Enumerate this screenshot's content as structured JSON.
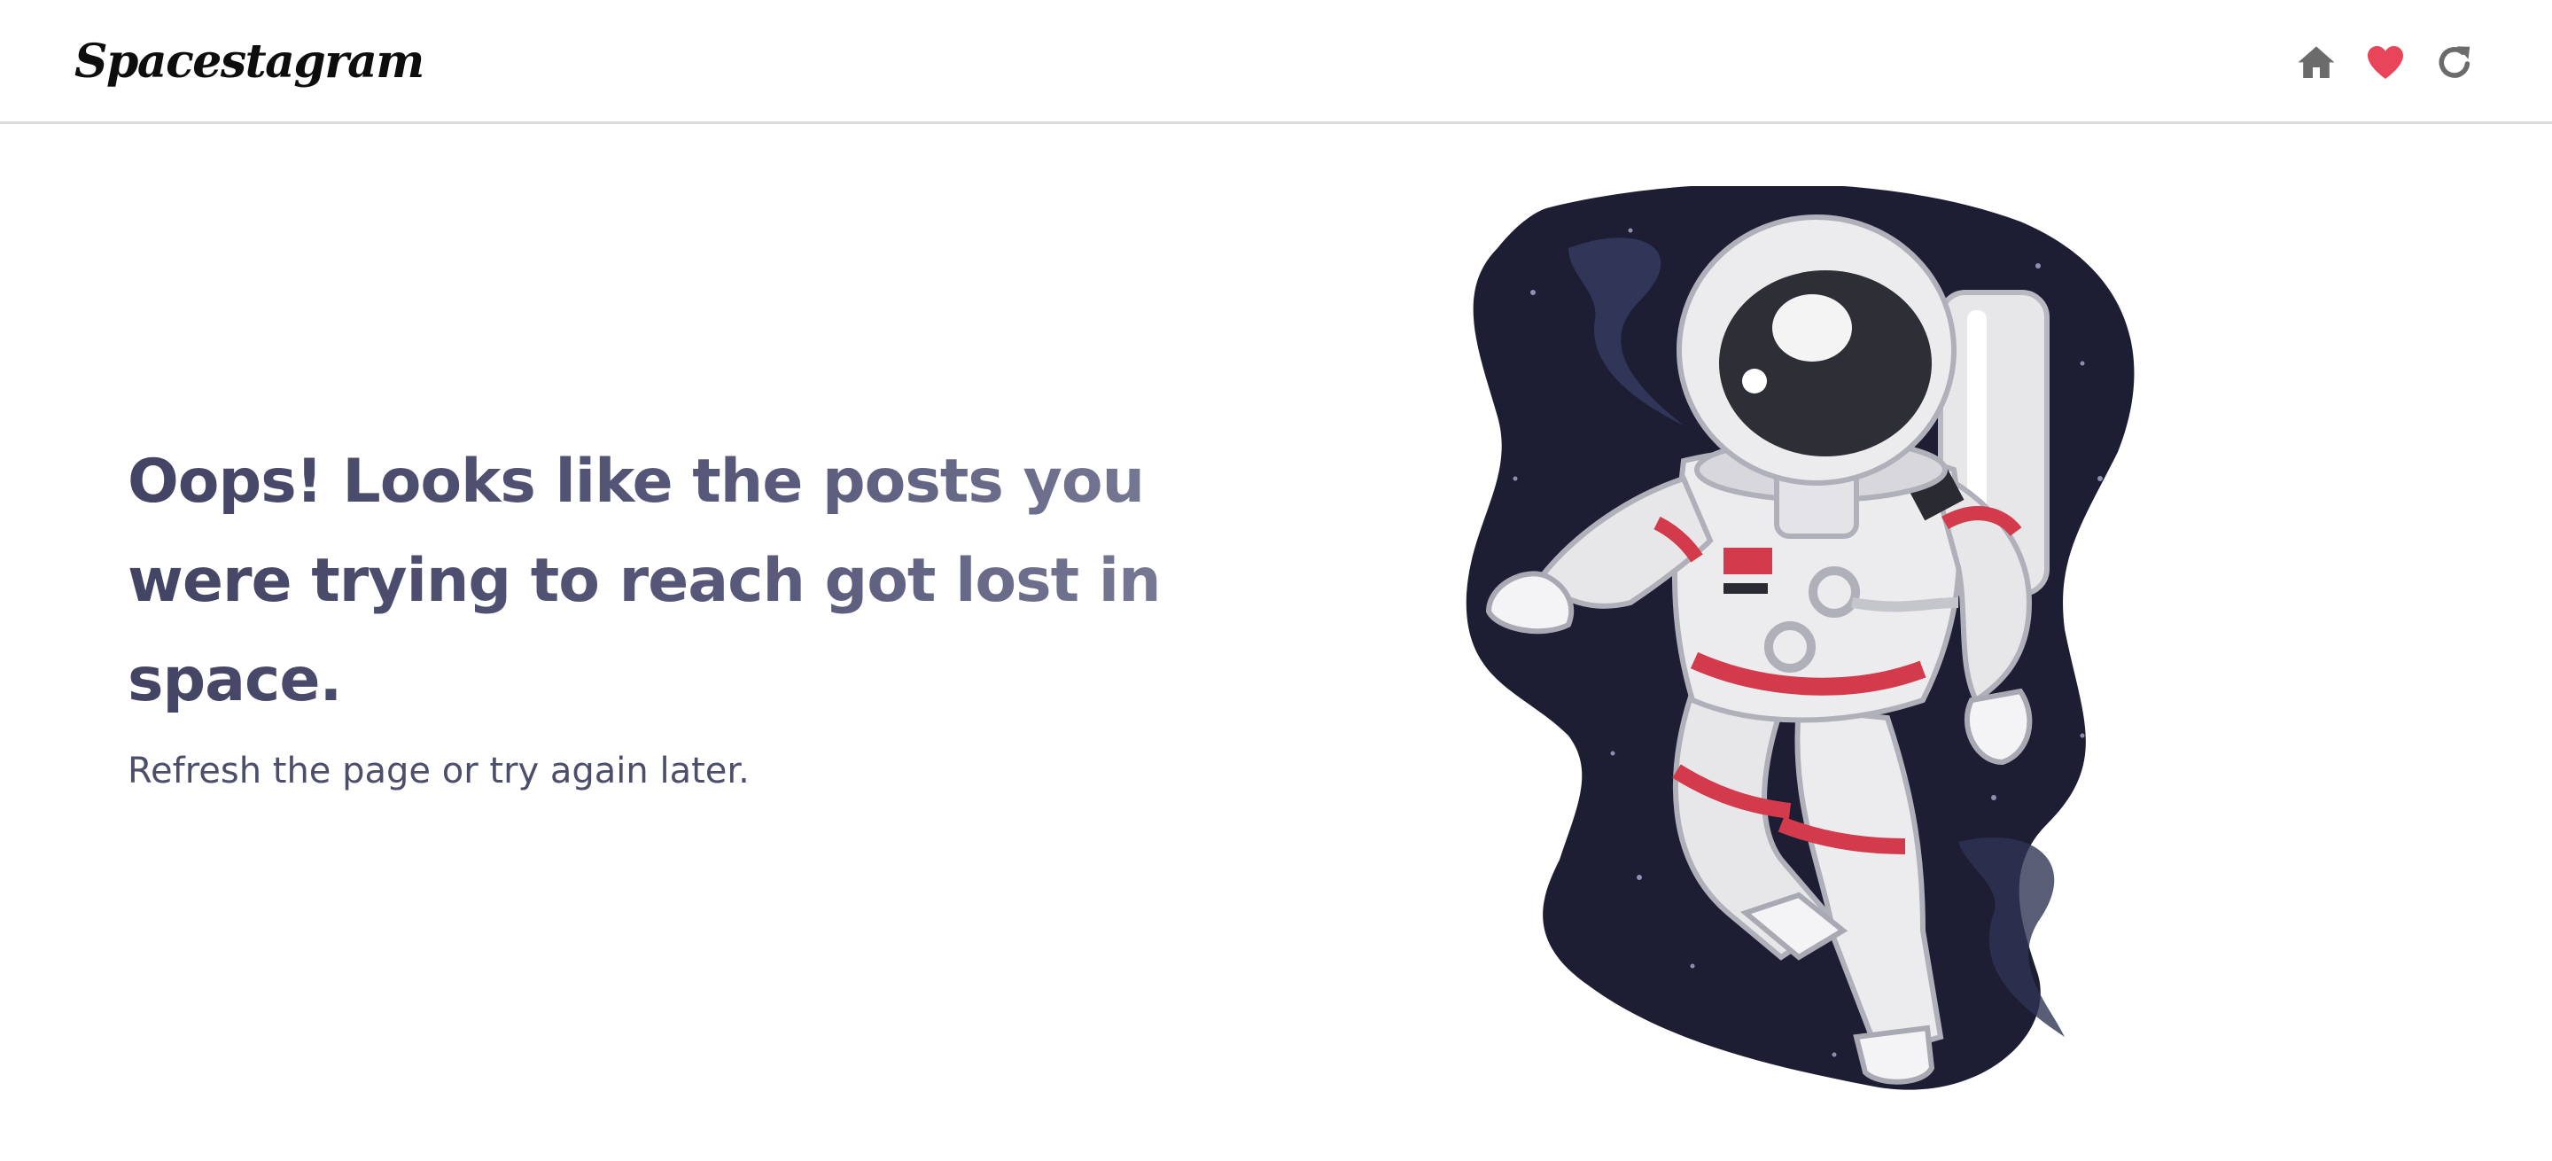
{
  "app": {
    "logo": "Spacestagram"
  },
  "nav": {
    "icons": [
      {
        "name": "home-icon",
        "color": "#6b6b6b"
      },
      {
        "name": "heart-icon",
        "color": "#e8445a"
      },
      {
        "name": "refresh-icon",
        "color": "#6b6b6b"
      }
    ]
  },
  "error": {
    "headline": "Oops! Looks like the posts you were trying to reach got lost in space.",
    "subtext": "Refresh the page or try again later."
  },
  "illustration": {
    "name": "astronaut-illustration",
    "background_color": "#1d1d33",
    "accent_color": "#d33a4c"
  }
}
